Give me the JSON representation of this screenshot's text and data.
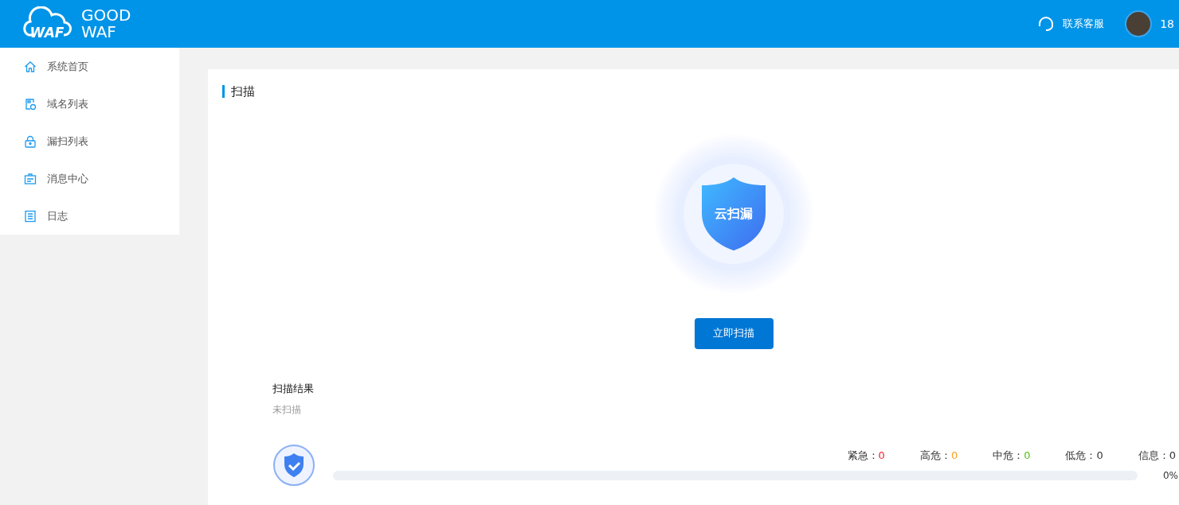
{
  "header": {
    "logo_text": [
      "GOOD",
      "WAF"
    ],
    "logo_mark": "WAF",
    "support": "联系客服",
    "user": "18"
  },
  "sidebar": {
    "items": [
      {
        "label": "系统首页",
        "kind": "home"
      },
      {
        "label": "域名列表",
        "kind": "domain"
      },
      {
        "label": "漏扫列表",
        "kind": "lock"
      },
      {
        "label": "消息中心",
        "kind": "message"
      },
      {
        "label": "日志",
        "kind": "log"
      }
    ]
  },
  "panel": {
    "title": "扫描",
    "badge": "云扫漏",
    "scan_button": "立即扫描",
    "result_title": "扫描结果",
    "result_status": "未扫描",
    "severities": [
      {
        "label": "紧急：",
        "count": "0",
        "color": "#f5222d"
      },
      {
        "label": "高危：",
        "count": "0",
        "color": "#fa9f1e"
      },
      {
        "label": "中危：",
        "count": "0",
        "color": "#52c41a"
      },
      {
        "label": "低危：",
        "count": "0",
        "color": "#333333"
      },
      {
        "label": "信息：",
        "count": "0",
        "color": "#333333"
      }
    ],
    "progress": {
      "level": 0,
      "reading": "0%"
    }
  }
}
